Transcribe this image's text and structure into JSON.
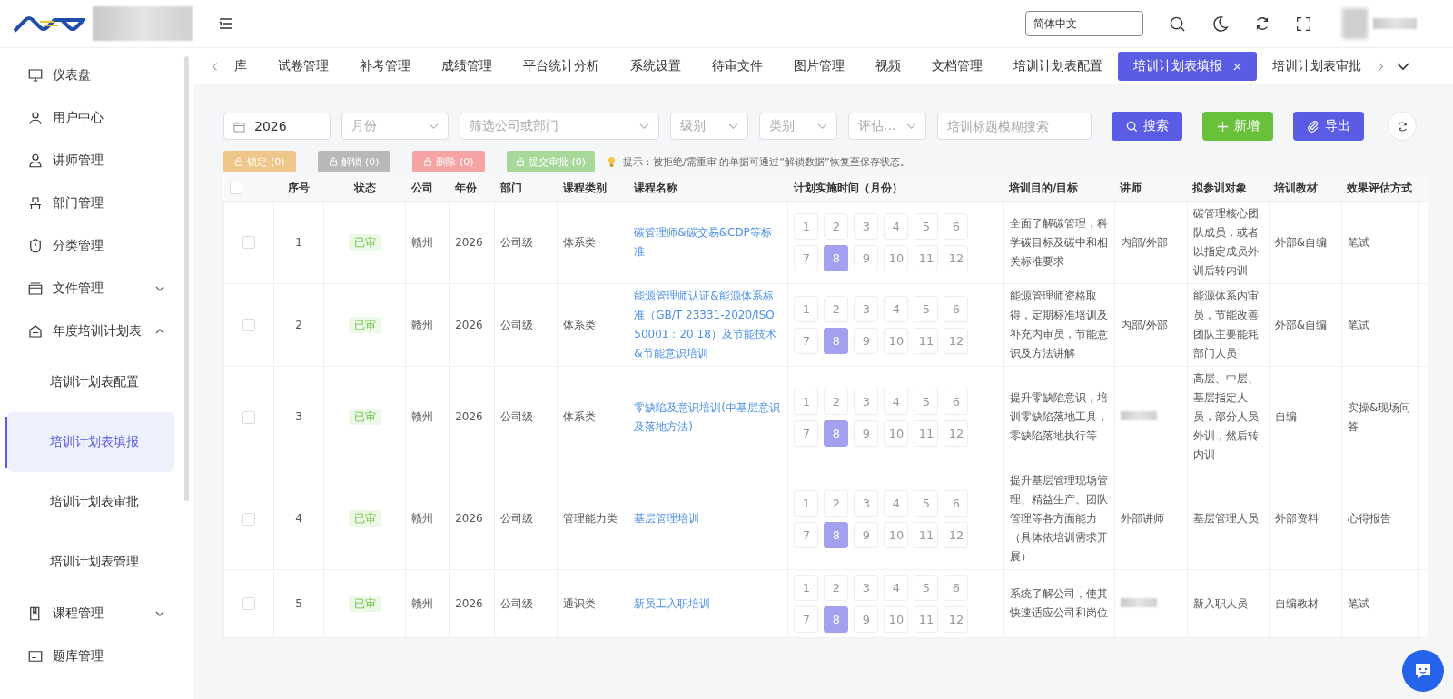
{
  "header": {
    "language": "简体中文"
  },
  "sidebar": {
    "items": [
      {
        "label": "仪表盘"
      },
      {
        "label": "用户中心"
      },
      {
        "label": "讲师管理"
      },
      {
        "label": "部门管理"
      },
      {
        "label": "分类管理"
      },
      {
        "label": "文件管理",
        "expanded": false
      },
      {
        "label": "年度培训计划表",
        "expanded": true,
        "children": [
          {
            "label": "培训计划表配置",
            "selected": false
          },
          {
            "label": "培训计划表填报",
            "selected": true
          },
          {
            "label": "培训计划表审批",
            "selected": false
          },
          {
            "label": "培训计划表管理",
            "selected": false
          }
        ]
      },
      {
        "label": "课程管理",
        "expanded": false
      },
      {
        "label": "题库管理"
      }
    ]
  },
  "tabs": [
    {
      "label": "库",
      "selected": false
    },
    {
      "label": "试卷管理",
      "selected": false
    },
    {
      "label": "补考管理",
      "selected": false
    },
    {
      "label": "成绩管理",
      "selected": false
    },
    {
      "label": "平台统计分析",
      "selected": false
    },
    {
      "label": "系统设置",
      "selected": false
    },
    {
      "label": "待审文件",
      "selected": false
    },
    {
      "label": "图片管理",
      "selected": false
    },
    {
      "label": "视频",
      "selected": false
    },
    {
      "label": "文档管理",
      "selected": false
    },
    {
      "label": "培训计划表配置",
      "selected": false
    },
    {
      "label": "培训计划表填报",
      "selected": true
    },
    {
      "label": "培训计划表审批",
      "selected": false
    }
  ],
  "filters": {
    "year": "2026",
    "selects": [
      {
        "placeholder": "月份"
      },
      {
        "placeholder": "筛选公司或部门"
      },
      {
        "placeholder": "级别"
      },
      {
        "placeholder": "类别"
      },
      {
        "placeholder": "评估..."
      }
    ],
    "search": {
      "placeholder": "培训标题模糊搜索"
    },
    "buttons": [
      {
        "label": "搜索",
        "kind": "search"
      },
      {
        "label": "新增",
        "kind": "add"
      },
      {
        "label": "导出",
        "kind": "export"
      }
    ]
  },
  "actions": [
    {
      "label": "锁定 (0)",
      "kind": "lock",
      "disabled": true
    },
    {
      "label": "解锁 (0)",
      "kind": "unlock",
      "disabled": true
    },
    {
      "label": "删除 (0)",
      "kind": "delete",
      "disabled": true
    },
    {
      "label": "提交审批 (0)",
      "kind": "submit",
      "disabled": true
    }
  ],
  "tip": "提示：被拒绝/需重审 的单据可通过“解锁数据”恢复至保存状态。",
  "table": {
    "columns": [
      "序号",
      "状态",
      "公司",
      "年份",
      "部门",
      "课程类别",
      "课程名称",
      "计划实施时间（月份）",
      "培训目的/目标",
      "讲师",
      "拟参训对象",
      "培训教材",
      "效果评估方式"
    ],
    "all_checked": false,
    "rows": [
      {
        "no": "1",
        "checked": false,
        "status": "已审",
        "company": "赣州",
        "year": "2026",
        "dept": "公司级",
        "category": "体系类",
        "name": "碳管理师&碳交易&CDP等标准",
        "months": [
          {
            "label": "1",
            "selected": false
          },
          {
            "label": "2",
            "selected": false
          },
          {
            "label": "3",
            "selected": false
          },
          {
            "label": "4",
            "selected": false
          },
          {
            "label": "5",
            "selected": false
          },
          {
            "label": "6",
            "selected": false
          },
          {
            "label": "7",
            "selected": false
          },
          {
            "label": "8",
            "selected": true
          },
          {
            "label": "9",
            "selected": false
          },
          {
            "label": "10",
            "selected": false
          },
          {
            "label": "11",
            "selected": false
          },
          {
            "label": "12",
            "selected": false
          }
        ],
        "goal": "全面了解碳管理，科学碳目标及碳中和相关标准要求",
        "teacher": "内部/外部",
        "audience": "碳管理核心团队成员，或者以指定成员外训后转内训",
        "material": "外部&自编",
        "evaluation": "笔试"
      },
      {
        "no": "2",
        "checked": false,
        "status": "已审",
        "company": "赣州",
        "year": "2026",
        "dept": "公司级",
        "category": "体系类",
        "name": "能源管理师认证&能源体系标准（GB/T 23331-2020/ISO 50001：20 18）及节能技术&节能意识培训",
        "months": [
          {
            "label": "1",
            "selected": false
          },
          {
            "label": "2",
            "selected": false
          },
          {
            "label": "3",
            "selected": false
          },
          {
            "label": "4",
            "selected": false
          },
          {
            "label": "5",
            "selected": false
          },
          {
            "label": "6",
            "selected": false
          },
          {
            "label": "7",
            "selected": false
          },
          {
            "label": "8",
            "selected": true
          },
          {
            "label": "9",
            "selected": false
          },
          {
            "label": "10",
            "selected": false
          },
          {
            "label": "11",
            "selected": false
          },
          {
            "label": "12",
            "selected": false
          }
        ],
        "goal": "能源管理师资格取得，定期标准培训及补充内审员，节能意识及方法讲解",
        "teacher": "内部/外部",
        "audience": "能源体系内审员，节能改善团队主要能耗部门人员",
        "material": "外部&自编",
        "evaluation": "笔试"
      },
      {
        "no": "3",
        "checked": false,
        "status": "已审",
        "company": "赣州",
        "year": "2026",
        "dept": "公司级",
        "category": "体系类",
        "name": "零缺陷及意识培训(中基层意识及落地方法)",
        "months": [
          {
            "label": "1",
            "selected": false
          },
          {
            "label": "2",
            "selected": false
          },
          {
            "label": "3",
            "selected": false
          },
          {
            "label": "4",
            "selected": false
          },
          {
            "label": "5",
            "selected": false
          },
          {
            "label": "6",
            "selected": false
          },
          {
            "label": "7",
            "selected": false
          },
          {
            "label": "8",
            "selected": true
          },
          {
            "label": "9",
            "selected": false
          },
          {
            "label": "10",
            "selected": false
          },
          {
            "label": "11",
            "selected": false
          },
          {
            "label": "12",
            "selected": false
          }
        ],
        "goal": "提升零缺陷意识，培训零缺陷落地工具，零缺陷落地执行等",
        "audience": "高层、中层、基层指定人员，部分人员外训，然后转内训",
        "material": "自编",
        "evaluation": "实操&现场问答"
      },
      {
        "no": "4",
        "checked": false,
        "status": "已审",
        "company": "赣州",
        "year": "2026",
        "dept": "公司级",
        "category": "管理能力类",
        "name": "基层管理培训",
        "months": [
          {
            "label": "1",
            "selected": false
          },
          {
            "label": "2",
            "selected": false
          },
          {
            "label": "3",
            "selected": false
          },
          {
            "label": "4",
            "selected": false
          },
          {
            "label": "5",
            "selected": false
          },
          {
            "label": "6",
            "selected": false
          },
          {
            "label": "7",
            "selected": false
          },
          {
            "label": "8",
            "selected": true
          },
          {
            "label": "9",
            "selected": false
          },
          {
            "label": "10",
            "selected": false
          },
          {
            "label": "11",
            "selected": false
          },
          {
            "label": "12",
            "selected": false
          }
        ],
        "goal": "提升基层管理现场管理、精益生产、团队管理等各方面能力（具体依培训需求开展）",
        "teacher": "外部讲师",
        "audience": "基层管理人员",
        "material": "外部资料",
        "evaluation": "心得报告"
      },
      {
        "no": "5",
        "checked": false,
        "status": "已审",
        "company": "赣州",
        "year": "2026",
        "dept": "公司级",
        "category": "通识类",
        "name": "新员工入职培训",
        "months": [
          {
            "label": "1",
            "selected": false
          },
          {
            "label": "2",
            "selected": false
          },
          {
            "label": "3",
            "selected": false
          },
          {
            "label": "4",
            "selected": false
          },
          {
            "label": "5",
            "selected": false
          },
          {
            "label": "6",
            "selected": false
          },
          {
            "label": "7",
            "selected": false
          },
          {
            "label": "8",
            "selected": true
          },
          {
            "label": "9",
            "selected": false
          },
          {
            "label": "10",
            "selected": false
          },
          {
            "label": "11",
            "selected": false
          },
          {
            "label": "12",
            "selected": false
          }
        ],
        "goal": "系统了解公司，使其快速适应公司和岗位",
        "audience": "新入职人员",
        "material": "自编教材",
        "evaluation": "笔试"
      }
    ]
  }
}
